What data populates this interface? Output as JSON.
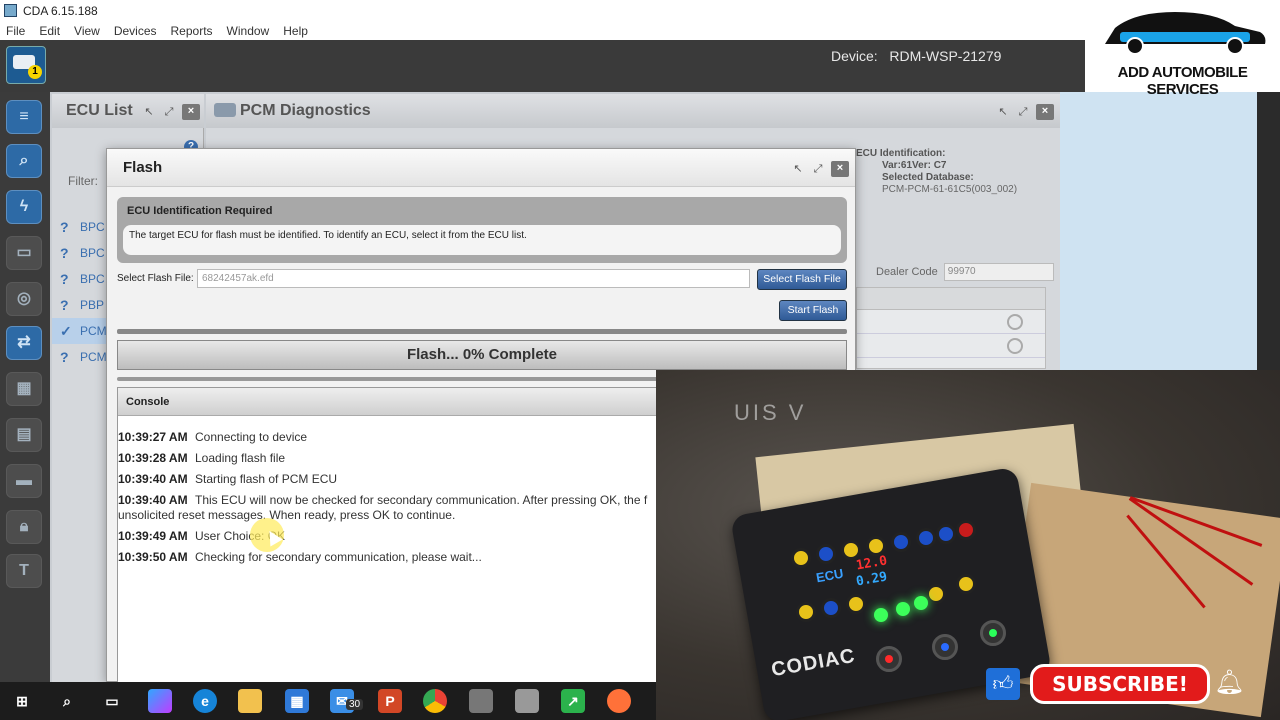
{
  "window": {
    "title": "CDA 6.15.188"
  },
  "menu": [
    "File",
    "Edit",
    "View",
    "Devices",
    "Reports",
    "Window",
    "Help"
  ],
  "device": {
    "label": "Device:",
    "value": "RDM-WSP-21279"
  },
  "app_badge": "1",
  "ecu_list": {
    "title": "ECU List",
    "filter_label": "Filter:",
    "items": [
      {
        "label": "BPC",
        "status": "?"
      },
      {
        "label": "BPC",
        "status": "?"
      },
      {
        "label": "BPC",
        "status": "?"
      },
      {
        "label": "PBP",
        "status": "?"
      },
      {
        "label": "PCM",
        "status": "✓",
        "selected": true
      },
      {
        "label": "PCM",
        "status": "?"
      }
    ]
  },
  "pcm": {
    "title": "PCM Diagnostics",
    "ecu_identification_label": "ECU Identification:",
    "var_ver": "Var:61Ver: C7",
    "selected_database_label": "Selected Database:",
    "selected_database_value": "PCM-PCM-61-61C5(003_002)",
    "dealer_code_label": "Dealer Code",
    "dealer_code_value": "99970"
  },
  "flash": {
    "title": "Flash",
    "id_required_heading": "ECU Identification Required",
    "id_required_message": "The target ECU for flash must be identified. To identify an ECU, select it from the ECU list.",
    "select_file_label": "Select Flash File:",
    "select_file_value": "68242457ak.efd",
    "select_file_button": "Select Flash File",
    "start_button": "Start Flash",
    "progress_percent": 0,
    "progress_text": "Flash... 0% Complete",
    "console_title": "Console",
    "log": [
      {
        "time": "10:39:27 AM",
        "text": "Connecting to device"
      },
      {
        "time": "10:39:28 AM",
        "text": "Loading flash file"
      },
      {
        "time": "10:39:40 AM",
        "text": "Starting flash of PCM ECU"
      },
      {
        "time": "10:39:40 AM",
        "text": "This ECU will now be checked for secondary communication. After pressing OK, the f",
        "continuation": "unsolicited reset messages. When ready, press OK to continue."
      },
      {
        "time": "10:39:49 AM",
        "text": "User Choice: OK"
      },
      {
        "time": "10:39:50 AM",
        "text": "Checking for secondary communication, please wait..."
      }
    ]
  },
  "logo": {
    "name": "ADD AUTOMOBILE SERVICES"
  },
  "photo": {
    "brand": "CODIAC",
    "ecu_label": "ECU",
    "voltage_1": "12.0",
    "voltage_2": "0.29",
    "bg_text": "UIS V"
  },
  "subscribe": {
    "label": "SUBSCRIBE!"
  },
  "taskbar": {
    "mail_count": "30"
  },
  "colors": {
    "accent": "#2f5a96",
    "subscribe": "#e21b1b",
    "led": "#3cff5a"
  }
}
